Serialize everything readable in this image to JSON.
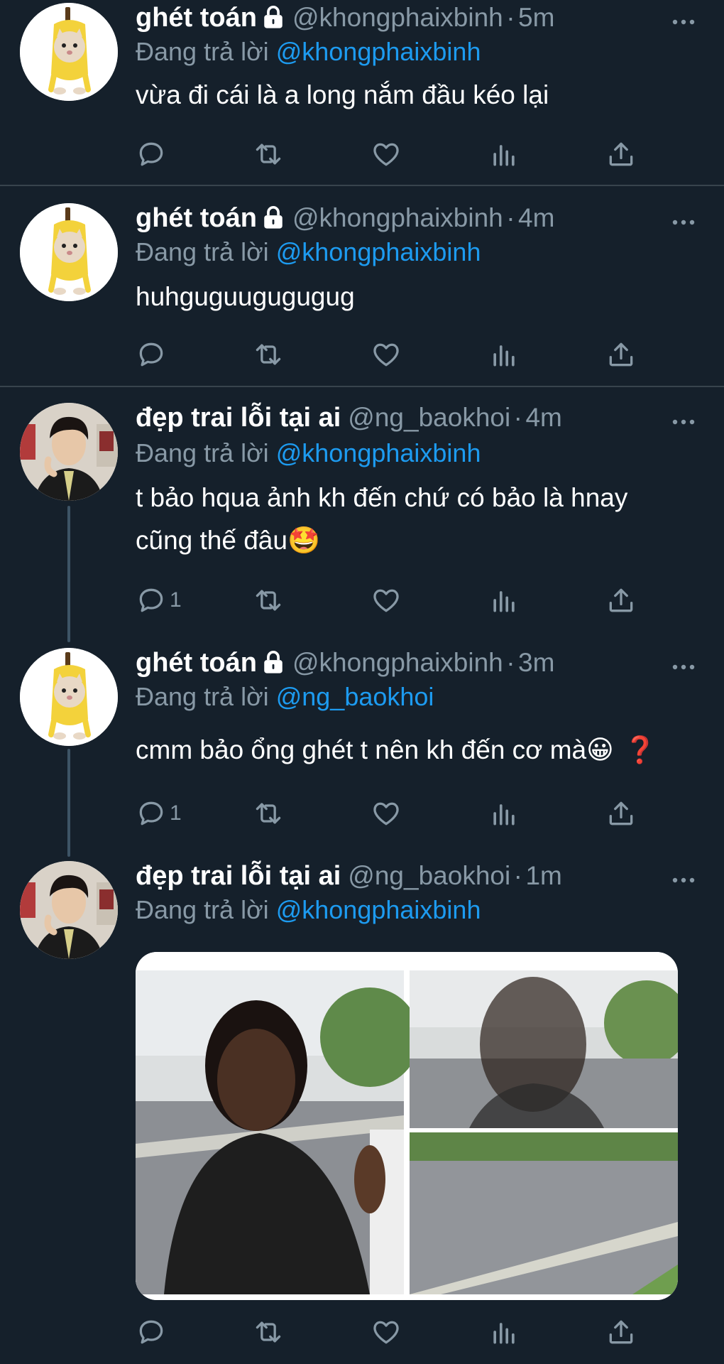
{
  "colors": {
    "background": "#15202b",
    "text": "#ffffff",
    "muted": "#8899a6",
    "link": "#1d9bf0",
    "divider": "#38444d"
  },
  "tweets": [
    {
      "name": "ghét toán",
      "locked": true,
      "handle": "@khongphaixbinh",
      "dot": "·",
      "time": "5m",
      "replying_prefix": "Đang trả lời",
      "replying_to": "@khongphaixbinh",
      "text_lines": [
        "vừa đi cái là a long nắm đầu kéo lại"
      ],
      "reply_count": ""
    },
    {
      "name": "ghét toán",
      "locked": true,
      "handle": "@khongphaixbinh",
      "dot": "·",
      "time": "4m",
      "replying_prefix": "Đang trả lời",
      "replying_to": "@khongphaixbinh",
      "text_lines": [
        "huhguguugugugug"
      ],
      "reply_count": ""
    },
    {
      "name": "đẹp trai lỗi tại ai",
      "locked": false,
      "handle": "@ng_baokhoi",
      "dot": "·",
      "time": "4m",
      "replying_prefix": "Đang trả lời",
      "replying_to": "@khongphaixbinh",
      "text_lines": [
        "t bảo hqua ảnh kh đến chứ có bảo là hnay",
        "cũng thế đâu🤩"
      ],
      "reply_count": "1"
    },
    {
      "name": "ghét toán",
      "locked": true,
      "handle": "@khongphaixbinh",
      "dot": "·",
      "time": "3m",
      "replying_prefix": "Đang trả lời",
      "replying_to": "@ng_baokhoi",
      "text_lines": [
        "cmm bảo ổng ghét t nên kh đến cơ mà😀"
      ],
      "text_suffix": "❓",
      "reply_count": "1"
    },
    {
      "name": "đẹp trai lỗi tại ai",
      "locked": false,
      "handle": "@ng_baokhoi",
      "dot": "·",
      "time": "1m",
      "replying_prefix": "Đang trả lời",
      "replying_to": "@khongphaixbinh",
      "text_lines": [],
      "media": "photo-collage",
      "reply_count": ""
    }
  ],
  "icons": {
    "reply": "reply-icon",
    "retweet": "retweet-icon",
    "like": "like-icon",
    "analytics": "analytics-icon",
    "share": "share-icon",
    "more": "more-icon",
    "lock": "lock-icon"
  }
}
